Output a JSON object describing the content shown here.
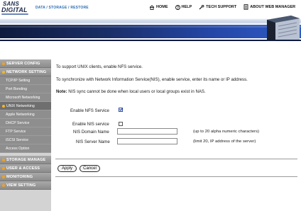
{
  "header": {
    "logo_line1": "SANS",
    "logo_line2": "DIGITAL",
    "breadcrumb": "DATA / STORAGE / RESTORE",
    "links": {
      "home": "HOME",
      "help": "HELP",
      "tech_support": "TECH SUPPORT",
      "about": "ABOUT WEB MANAGER"
    }
  },
  "sidebar": {
    "server_config": "SERVER CONFIG",
    "network_setting": "NETWORK SETTING",
    "network_items": [
      "TCP/IP Setting",
      "Port Bonding",
      "Microsoft Networking",
      "UNIX Networking",
      "Apple Networking",
      "DHCP Service",
      "FTP Service",
      "iSCSI Service",
      "Access Option"
    ],
    "storage_manage": "STORAGE MANAGE",
    "user_access": "USER & ACCESS",
    "monitoring": "MONITORING",
    "view_setting": "VIEW SETTING"
  },
  "main": {
    "intro1": "To support UNIX clients, enable NFS service.",
    "intro2": "To synchronize with Network Information Service(NIS), enable service, enter its name or IP address.",
    "note_label": "Note:",
    "note_text": " NIS sync cannot be done when local users or local groups exist in NAS.",
    "nfs_label": "Enable NFS Service",
    "nfs_checked": true,
    "nis_label": "Enable NIS service",
    "nis_checked": false,
    "nis_domain_label": "NIS Domain Name",
    "nis_domain_value": "",
    "nis_domain_hint": "(up to 20 alpha numeric characters)",
    "nis_server_label": "NIS Server Name",
    "nis_server_value": "",
    "nis_server_hint": "(limit 20, IP address of the server)",
    "apply_label": "Apply",
    "cancel_label": "Cancel"
  },
  "colors": {
    "accent": "#f7b52b",
    "link_blue": "#2b6cb5",
    "banner_dark": "#0e1a3d",
    "banner_light": "#2e5cc8"
  }
}
